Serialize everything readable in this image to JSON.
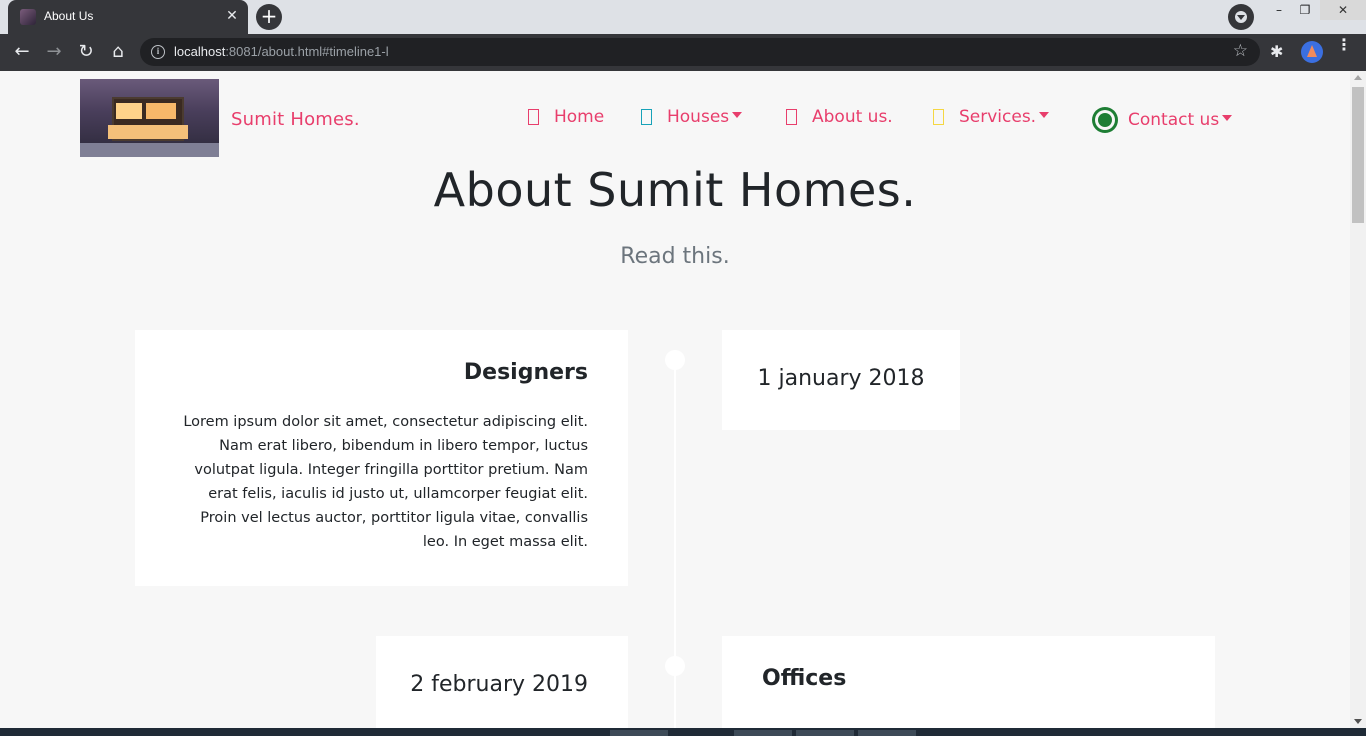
{
  "browser": {
    "tab_title": "About Us",
    "tab_close": "✕",
    "new_tab": "+",
    "window_min": "–",
    "window_max": "❐",
    "window_close": "✕",
    "url_host": "localhost",
    "url_rest": ":8081/about.html#timeline1-l",
    "icons": {
      "back": "←",
      "forward": "→",
      "reload": "↻",
      "home": "⌂",
      "info": "i",
      "star": "☆",
      "extensions": "✱",
      "menu": "⋮"
    }
  },
  "site": {
    "brand": "Sumit Homes.",
    "nav": [
      {
        "label": "Home",
        "color": "#e83e6c"
      },
      {
        "label": "Houses",
        "color": "#17a2b8",
        "dropdown": true
      },
      {
        "label": "About us.",
        "color": "#e83e6c"
      },
      {
        "label": "Services.",
        "color": "#f5d742",
        "dropdown": true
      },
      {
        "label": "Contact us",
        "color": "#1e7e34",
        "dropdown": true
      }
    ],
    "accent_color": "#e83e6c"
  },
  "main": {
    "title": "About Sumit Homes.",
    "subtitle": "Read this.",
    "timeline": [
      {
        "heading": "Designers",
        "text": "Lorem ipsum dolor sit amet, consectetur adipiscing elit. Nam erat libero, bibendum in libero tempor, luctus volutpat ligula. Integer fringilla porttitor pretium. Nam erat felis, iaculis id justo ut, ullamcorper feugiat elit. Proin vel lectus auctor, porttitor ligula vitae, convallis leo. In eget massa elit.",
        "date": "1 january 2018"
      },
      {
        "heading": "Offices",
        "date": "2 february 2019"
      }
    ]
  }
}
